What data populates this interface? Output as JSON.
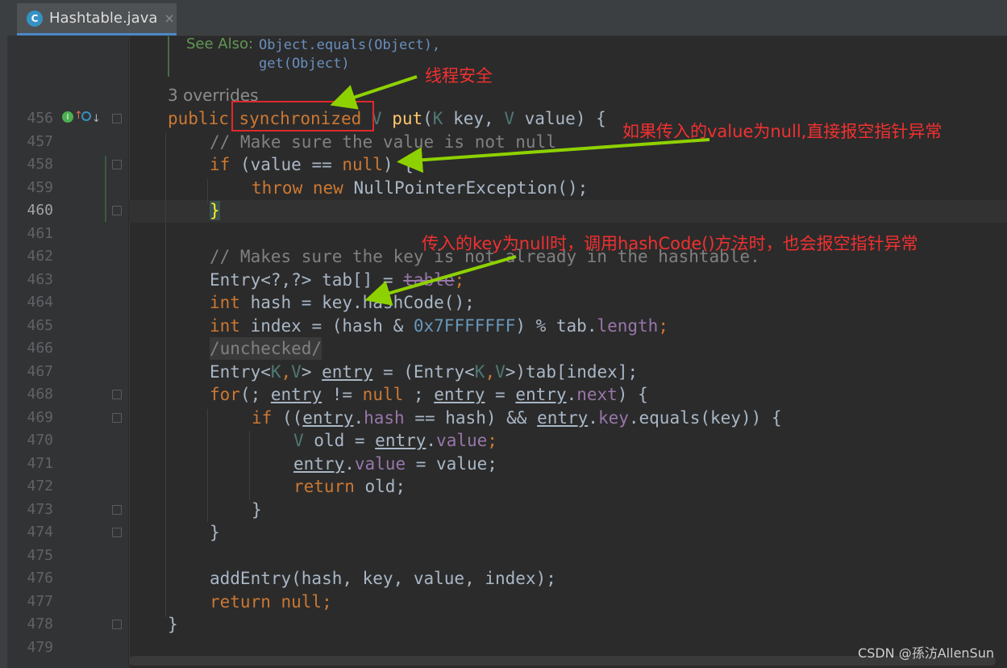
{
  "tab": {
    "title": "Hashtable.java",
    "icon": "class-c-icon",
    "close": "×"
  },
  "doc": {
    "see_also_label": "See Also:",
    "see_also_1": "Object.equals(Object),",
    "see_also_2": "get(Object)"
  },
  "overrides": "3 overrides",
  "line_numbers": [
    "456",
    "457",
    "458",
    "459",
    "460",
    "461",
    "462",
    "463",
    "464",
    "465",
    "466",
    "467",
    "468",
    "469",
    "470",
    "471",
    "472",
    "473",
    "474",
    "475",
    "476",
    "477",
    "478",
    "479"
  ],
  "current_line": "460",
  "code": {
    "l456_public": "public",
    "l456_sync": "synchronized",
    "l456_V": "V",
    "l456_put": "put",
    "l456_rest1": "(",
    "l456_K": "K",
    "l456_key": " key, ",
    "l456_V2": "V",
    "l456_rest2": " value) {",
    "l457": "// Make sure the value is not null",
    "l458_if": "if",
    "l458_a": " (value == ",
    "l458_null": "null",
    "l458_b": ") {",
    "l459_throw": "throw new",
    "l459_rest": " NullPointerException();",
    "l460": "}",
    "l462": "// Makes sure the key is not already in the hashtable.",
    "l463_a": "Entry<?,?> tab[] = ",
    "l463_table": "table",
    "l463_b": ";",
    "l464_int": "int",
    "l464_rest": " hash = key.hashCode();",
    "l465_int": "int",
    "l465_a": " index = (hash & ",
    "l465_num": "0x7FFFFFFF",
    "l465_b": ") % tab.",
    "l465_len": "length",
    "l465_c": ";",
    "l466": "/unchecked/",
    "l467_a": "Entry<",
    "l467_K": "K",
    "l467_comma": ",",
    "l467_V": "V",
    "l467_b": "> ",
    "l467_entry": "entry",
    "l467_c": " = (Entry<",
    "l467_K2": "K",
    "l467_comma2": ",",
    "l467_V2": "V",
    "l467_d": ">)tab[index];",
    "l468_for": "for",
    "l468_a": "(; ",
    "l468_e1": "entry",
    "l468_b": " != ",
    "l468_null": "null",
    "l468_c": " ; ",
    "l468_e2": "entry",
    "l468_d": " = ",
    "l468_e3": "entry",
    "l468_dot": ".",
    "l468_next": "next",
    "l468_e": ") {",
    "l469_if": "if",
    "l469_a": " ((",
    "l469_e1": "entry",
    "l469_dot": ".",
    "l469_hash": "hash",
    "l469_b": " == hash) && ",
    "l469_e2": "entry",
    "l469_dot2": ".",
    "l469_key": "key",
    "l469_c": ".equals(key)) {",
    "l470_V": "V",
    "l470_a": " old = ",
    "l470_e": "entry",
    "l470_dot": ".",
    "l470_value": "value",
    "l470_b": ";",
    "l471_e": "entry",
    "l471_dot": ".",
    "l471_value": "value",
    "l471_a": " = value;",
    "l472_ret": "return",
    "l472_a": " old;",
    "l473": "}",
    "l474": "}",
    "l476": "addEntry(hash, key, value, index);",
    "l477_ret": "return null",
    "l477_a": ";",
    "l478": "}"
  },
  "annotations": {
    "thread_safe": "线程安全",
    "value_null": "如果传入的value为null,直接报空指针异常",
    "key_null": "传入的key为null时，调用hashCode()方法时，也会报空指针异常"
  },
  "watermark": "CSDN @孫汸AllenSun"
}
